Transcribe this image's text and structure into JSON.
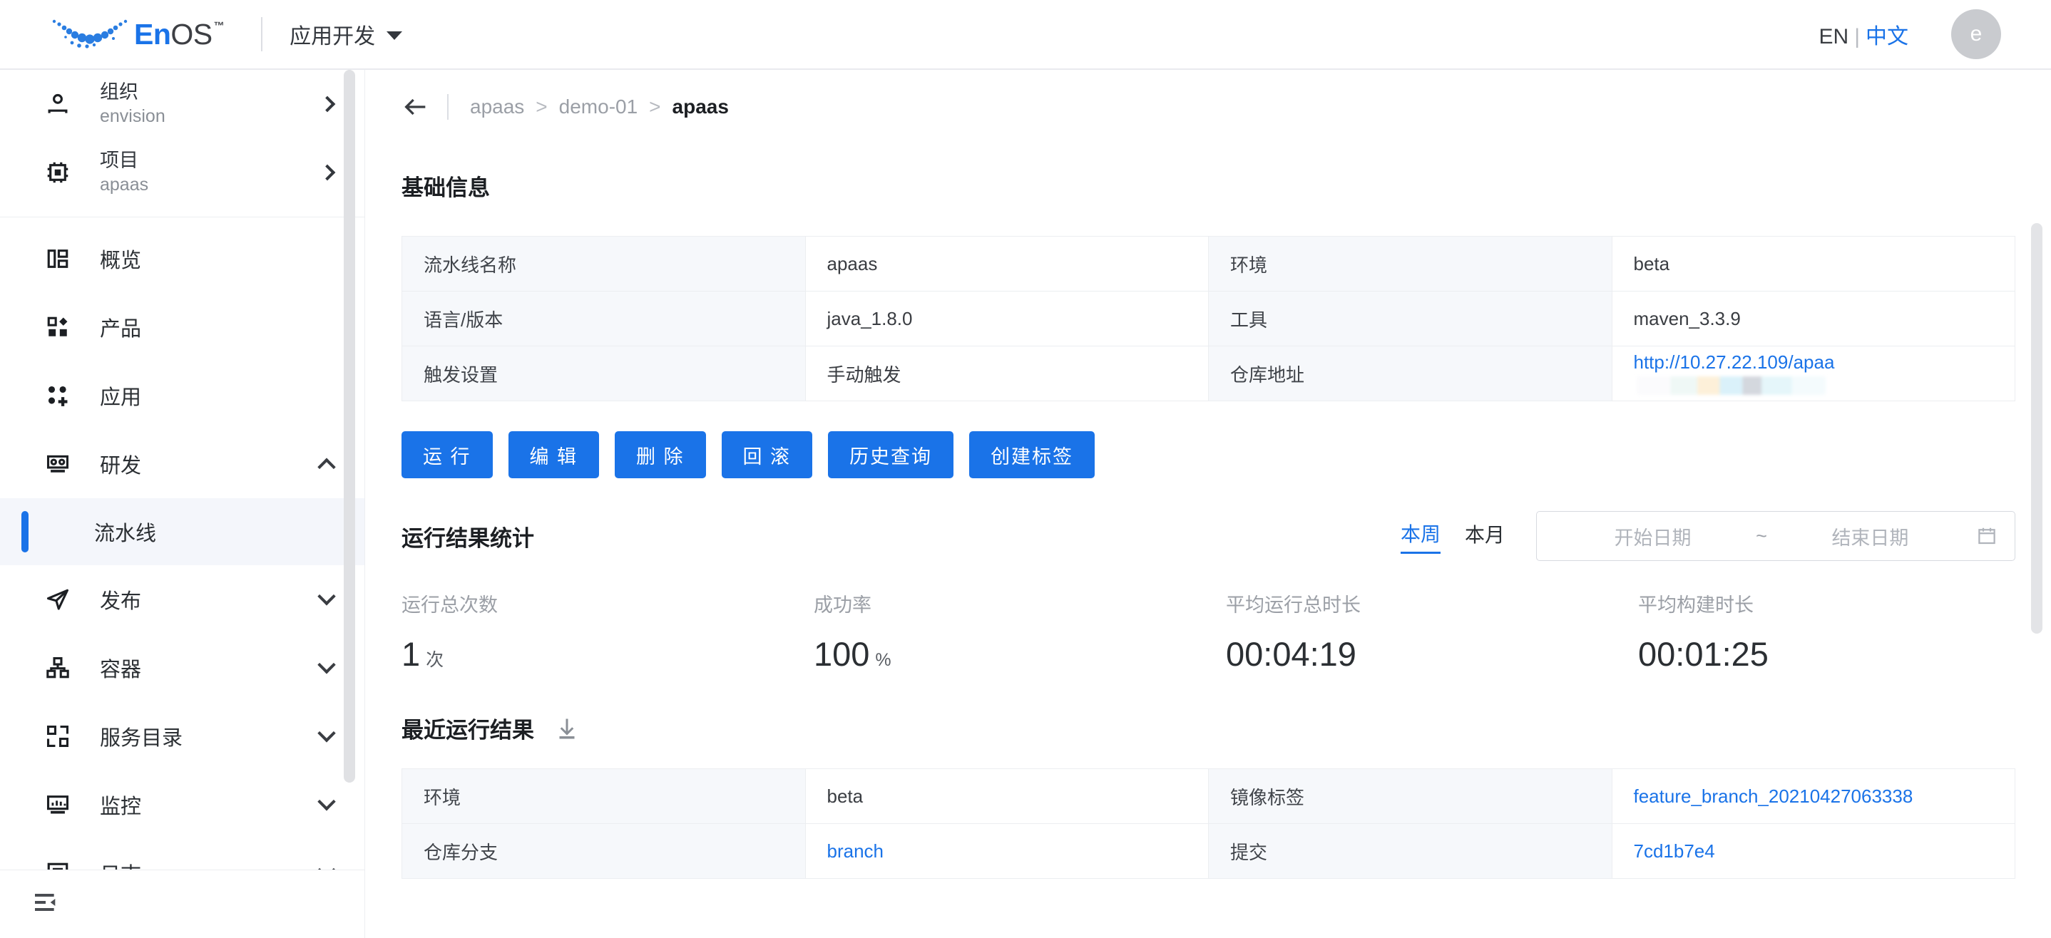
{
  "topbar": {
    "logo_text_primary": "En",
    "logo_text_secondary": "OS",
    "logo_trademark": "™",
    "app_selector_label": "应用开发",
    "lang_en": "EN",
    "lang_sep": "|",
    "lang_zh": "中文",
    "avatar_initial": "e",
    "accent_color": "#1a73e8"
  },
  "sidebar": {
    "context_items": [
      {
        "title": "组织",
        "subtitle": "envision",
        "icon": "user-icon"
      },
      {
        "title": "项目",
        "subtitle": "apaas",
        "icon": "project-chip-icon"
      }
    ],
    "nav_items": [
      {
        "label": "概览",
        "icon": "overview-icon",
        "chevron": "none"
      },
      {
        "label": "产品",
        "icon": "product-icon",
        "chevron": "none"
      },
      {
        "label": "应用",
        "icon": "application-icon",
        "chevron": "none"
      },
      {
        "label": "研发",
        "icon": "development-icon",
        "chevron": "up"
      },
      {
        "label": "发布",
        "icon": "release-send-icon",
        "chevron": "down"
      },
      {
        "label": "容器",
        "icon": "container-icon",
        "chevron": "down"
      },
      {
        "label": "服务目录",
        "icon": "service-catalog-icon",
        "chevron": "down"
      },
      {
        "label": "监控",
        "icon": "monitor-icon",
        "chevron": "down"
      },
      {
        "label": "日志",
        "icon": "log-icon",
        "chevron": "down"
      }
    ],
    "sub_item_active": "流水线",
    "collapse_icon": "collapse-sidebar-icon"
  },
  "breadcrumb": {
    "back_icon": "back-arrow-icon",
    "items": [
      "apaas",
      "demo-01",
      "apaas"
    ],
    "separator": ">"
  },
  "basic_info": {
    "title": "基础信息",
    "rows": [
      {
        "k1": "流水线名称",
        "v1": "apaas",
        "k2": "环境",
        "v2": "beta",
        "v2_type": "text"
      },
      {
        "k1": "语言/版本",
        "v1": "java_1.8.0",
        "k2": "工具",
        "v2": "maven_3.3.9",
        "v2_type": "text"
      },
      {
        "k1": "触发设置",
        "v1": "手动触发",
        "k2": "仓库地址",
        "v2": "http://10.27.22.109/apaa",
        "v2_type": "link-redacted"
      }
    ]
  },
  "actions": {
    "buttons": [
      {
        "label": "运 行",
        "name": "run-button"
      },
      {
        "label": "编 辑",
        "name": "edit-button"
      },
      {
        "label": "删 除",
        "name": "delete-button"
      },
      {
        "label": "回 滚",
        "name": "rollback-button"
      },
      {
        "label": "历史查询",
        "name": "history-query-button"
      },
      {
        "label": "创建标签",
        "name": "create-tag-button"
      }
    ]
  },
  "stats": {
    "title": "运行结果统计",
    "range_tabs": [
      {
        "label": "本周",
        "active": true
      },
      {
        "label": "本月",
        "active": false
      }
    ],
    "date_range": {
      "start_placeholder": "开始日期",
      "tilde": "~",
      "end_placeholder": "结束日期",
      "calendar_icon": "calendar-icon"
    },
    "metrics": [
      {
        "label": "运行总次数",
        "value": "1",
        "unit": "次"
      },
      {
        "label": "成功率",
        "value": "100",
        "unit": "%"
      },
      {
        "label": "平均运行总时长",
        "value": "00:04:19",
        "unit": ""
      },
      {
        "label": "平均构建时长",
        "value": "00:01:25",
        "unit": ""
      }
    ]
  },
  "recent": {
    "title": "最近运行结果",
    "download_icon": "download-icon",
    "rows": [
      {
        "k1": "环境",
        "v1": "beta",
        "v1_type": "text",
        "k2": "镜像标签",
        "v2": "feature_branch_20210427063338",
        "v2_type": "link"
      },
      {
        "k1": "仓库分支",
        "v1": "branch",
        "v1_type": "link",
        "k2": "提交",
        "v2": "7cd1b7e4",
        "v2_type": "link"
      }
    ]
  }
}
